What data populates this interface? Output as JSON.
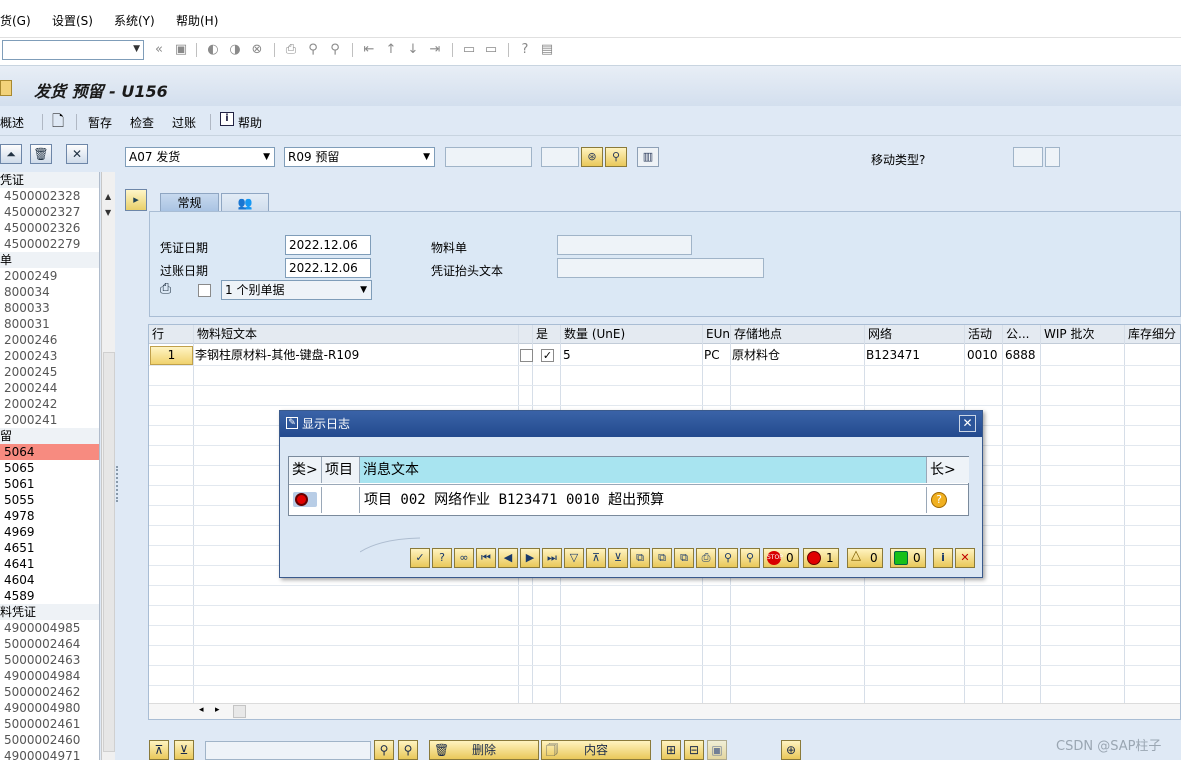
{
  "menu": [
    "货(G)",
    "设置(S)",
    "系统(Y)",
    "帮助(H)"
  ],
  "title": "发货 预留 - U156",
  "app_toolbar": {
    "overview": "概述",
    "hold": "暂存",
    "check": "检查",
    "post": "过账",
    "help": "帮助"
  },
  "header": {
    "action": "A07 发货",
    "reference": "R09 预留",
    "movement_type_label": "移动类型?"
  },
  "tabs": {
    "general": "常规"
  },
  "form": {
    "doc_date_label": "凭证日期",
    "doc_date": "2022.12.06",
    "post_date_label": "过账日期",
    "post_date": "2022.12.06",
    "material_slip_label": "物料单",
    "header_text_label": "凭证抬头文本",
    "slip_option": "1 个别单据"
  },
  "tree": [
    {
      "text": "凭证",
      "type": "hdr"
    },
    {
      "text": "4500002328",
      "type": "item"
    },
    {
      "text": "4500002327",
      "type": "item"
    },
    {
      "text": "4500002326",
      "type": "item"
    },
    {
      "text": "4500002279",
      "type": "item"
    },
    {
      "text": "单",
      "type": "hdr"
    },
    {
      "text": "2000249",
      "type": "item"
    },
    {
      "text": "800034",
      "type": "item"
    },
    {
      "text": "800033",
      "type": "item"
    },
    {
      "text": "800031",
      "type": "item"
    },
    {
      "text": "2000246",
      "type": "item"
    },
    {
      "text": "2000243",
      "type": "item"
    },
    {
      "text": "2000245",
      "type": "item"
    },
    {
      "text": "2000244",
      "type": "item"
    },
    {
      "text": "2000242",
      "type": "item"
    },
    {
      "text": "2000241",
      "type": "item"
    },
    {
      "text": "留",
      "type": "hdr"
    },
    {
      "text": "5064",
      "type": "sel"
    },
    {
      "text": "5065",
      "type": "dark"
    },
    {
      "text": "5061",
      "type": "dark"
    },
    {
      "text": "5055",
      "type": "dark"
    },
    {
      "text": "4978",
      "type": "dark"
    },
    {
      "text": "4969",
      "type": "dark"
    },
    {
      "text": "4651",
      "type": "dark"
    },
    {
      "text": "4641",
      "type": "dark"
    },
    {
      "text": "4604",
      "type": "dark"
    },
    {
      "text": "4589",
      "type": "dark"
    },
    {
      "text": "料凭证",
      "type": "hdr"
    },
    {
      "text": "4900004985",
      "type": "item"
    },
    {
      "text": "5000002464",
      "type": "item"
    },
    {
      "text": "5000002463",
      "type": "item"
    },
    {
      "text": "4900004984",
      "type": "item"
    },
    {
      "text": "5000002462",
      "type": "item"
    },
    {
      "text": "4900004980",
      "type": "item"
    },
    {
      "text": "5000002461",
      "type": "item"
    },
    {
      "text": "5000002460",
      "type": "item"
    },
    {
      "text": "4900004971",
      "type": "item"
    }
  ],
  "table": {
    "headers": [
      "行",
      "物料短文本",
      "",
      "是",
      "数量 (UnE)",
      "EUn",
      "存储地点",
      "网络",
      "活动",
      "公...",
      "WIP 批次",
      "库存细分"
    ],
    "row": {
      "line": "1",
      "material_text": "李钢柱原材料-其他-键盘-R109",
      "qty": "5",
      "unit": "PC",
      "storage": "原材料仓",
      "network": "B123471",
      "activity": "0010",
      "company": "6888"
    }
  },
  "bottom": {
    "delete": "删除",
    "contents": "内容"
  },
  "dialog": {
    "title": "显示日志",
    "headers": [
      "类>",
      "项目",
      "消息文本",
      "长>"
    ],
    "message": "项目 002 网络作业 B123471 0010 超出预算",
    "counts": {
      "stop": "0",
      "error": "1",
      "warning": "0",
      "success": "0"
    }
  },
  "watermark": "CSDN @SAP柱子",
  "colors": {
    "selected_row": "#f78b80",
    "title_bar": "#2c559a",
    "message_header": "#a8e4f0"
  }
}
